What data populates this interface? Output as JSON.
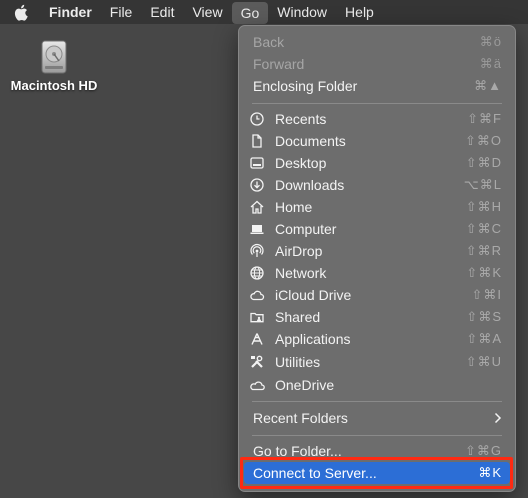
{
  "menubar": {
    "items": [
      {
        "label": "Finder"
      },
      {
        "label": "File"
      },
      {
        "label": "Edit"
      },
      {
        "label": "View"
      },
      {
        "label": "Go"
      },
      {
        "label": "Window"
      },
      {
        "label": "Help"
      }
    ],
    "active": "Go"
  },
  "desktop": {
    "drive_label": "Macintosh HD"
  },
  "go_menu": {
    "nav": [
      {
        "label": "Back",
        "shortcut": "⌘ö",
        "enabled": false
      },
      {
        "label": "Forward",
        "shortcut": "⌘ä",
        "enabled": false
      },
      {
        "label": "Enclosing Folder",
        "shortcut": "⌘▲",
        "enabled": true
      }
    ],
    "places": [
      {
        "label": "Recents",
        "shortcut": "⇧⌘F",
        "icon": "clock-icon"
      },
      {
        "label": "Documents",
        "shortcut": "⇧⌘O",
        "icon": "document-icon"
      },
      {
        "label": "Desktop",
        "shortcut": "⇧⌘D",
        "icon": "desktop-icon"
      },
      {
        "label": "Downloads",
        "shortcut": "⌥⌘L",
        "icon": "download-icon"
      },
      {
        "label": "Home",
        "shortcut": "⇧⌘H",
        "icon": "home-icon"
      },
      {
        "label": "Computer",
        "shortcut": "⇧⌘C",
        "icon": "laptop-icon"
      },
      {
        "label": "AirDrop",
        "shortcut": "⇧⌘R",
        "icon": "airdrop-icon"
      },
      {
        "label": "Network",
        "shortcut": "⇧⌘K",
        "icon": "globe-icon"
      },
      {
        "label": "iCloud Drive",
        "shortcut": "⇧⌘I",
        "icon": "cloud-icon"
      },
      {
        "label": "Shared",
        "shortcut": "⇧⌘S",
        "icon": "shared-folder-icon"
      },
      {
        "label": "Applications",
        "shortcut": "⇧⌘A",
        "icon": "applications-icon"
      },
      {
        "label": "Utilities",
        "shortcut": "⇧⌘U",
        "icon": "utilities-icon"
      },
      {
        "label": "OneDrive",
        "shortcut": "",
        "icon": "cloud-icon"
      }
    ],
    "recent_folders": {
      "label": "Recent Folders"
    },
    "go_to_folder": {
      "label": "Go to Folder...",
      "shortcut": "⇧⌘G"
    },
    "connect_to_server": {
      "label": "Connect to Server...",
      "shortcut": "⌘K"
    }
  },
  "colors": {
    "highlight": "#2c6ed6",
    "annotation_box": "#ff2a12"
  }
}
